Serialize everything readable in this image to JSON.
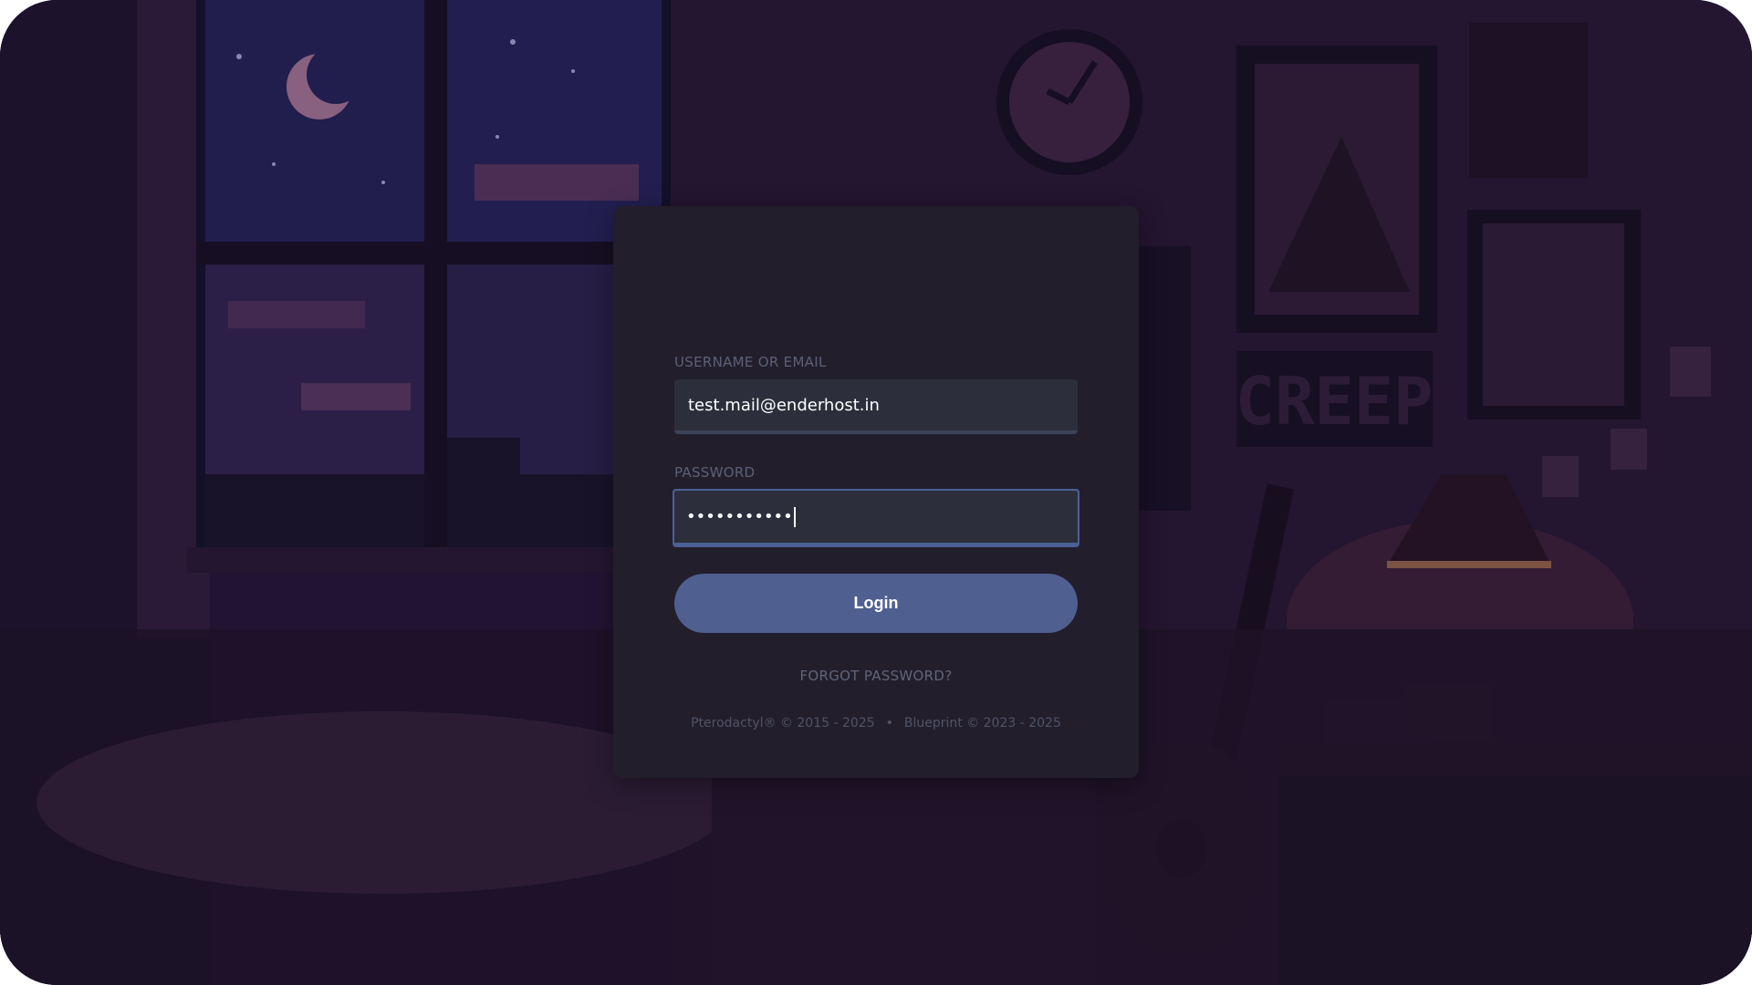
{
  "background": {
    "scene": "pixel-art bedroom at night",
    "poster_text": "CREEP"
  },
  "login": {
    "username_label": "USERNAME OR EMAIL",
    "username_value": "test.mail@enderhost.in",
    "password_label": "PASSWORD",
    "password_value": "•••••••••••",
    "submit_label": "Login",
    "forgot_link": "FORGOT PASSWORD?"
  },
  "footer": {
    "pterodactyl": "Pterodactyl® © 2015 - 2025",
    "separator": "•",
    "blueprint": "Blueprint © 2023 - 2025"
  },
  "colors": {
    "accent": "#4f5f90",
    "card_bg": "#231e2c",
    "input_bg": "#2c2f3b"
  }
}
